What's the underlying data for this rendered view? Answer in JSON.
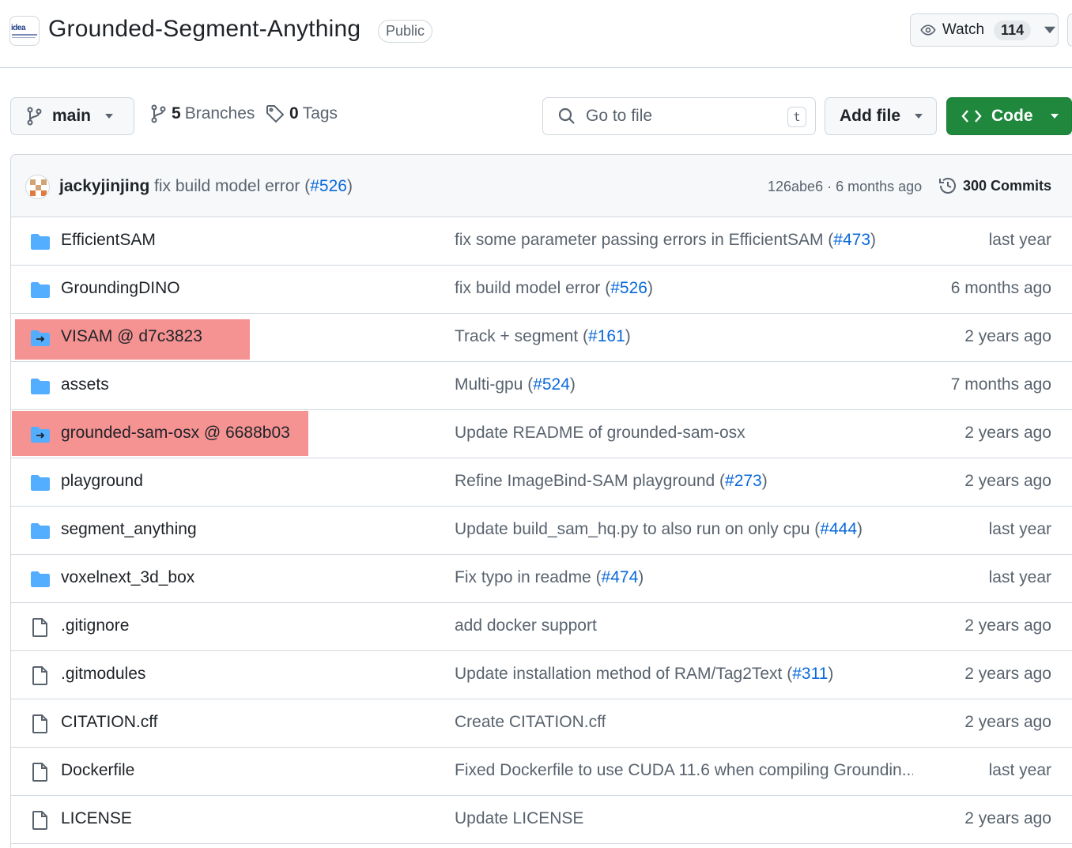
{
  "header": {
    "repo_name": "Grounded-Segment-Anything",
    "visibility": "Public",
    "watch_label": "Watch",
    "watch_count": "114",
    "logo_text": "idea"
  },
  "toolbar": {
    "branch": "main",
    "branches_count": "5",
    "branches_label": "Branches",
    "tags_count": "0",
    "tags_label": "Tags",
    "search_placeholder": "Go to file",
    "search_shortcut": "t",
    "add_file_label": "Add file",
    "code_label": "Code"
  },
  "latest_commit": {
    "author": "jackyjinjing",
    "message": "fix build model error (",
    "pr": "#526",
    "message_end": ")",
    "meta": "126abe6 · 6 months ago",
    "commits_label": "300 Commits"
  },
  "files": [
    {
      "name": "EfficientSAM",
      "type": "folder",
      "msg": "fix some parameter passing errors in EfficientSAM (",
      "pr": "#473",
      "msg_end": ")",
      "age": "last year"
    },
    {
      "name": "GroundingDINO",
      "type": "folder",
      "msg": "fix build model error (",
      "pr": "#526",
      "msg_end": ")",
      "age": "6 months ago"
    },
    {
      "name": "VISAM @ d7c3823",
      "type": "submodule",
      "msg": "Track + segment (",
      "pr": "#161",
      "msg_end": ")",
      "age": "2 years ago",
      "highlighted": true
    },
    {
      "name": "assets",
      "type": "folder",
      "msg": "Multi-gpu (",
      "pr": "#524",
      "msg_end": ")",
      "age": "7 months ago"
    },
    {
      "name": "grounded-sam-osx @ 6688b03",
      "type": "submodule",
      "msg": "Update README of grounded-sam-osx",
      "pr": "",
      "msg_end": "",
      "age": "2 years ago",
      "highlighted": true
    },
    {
      "name": "playground",
      "type": "folder",
      "msg": "Refine ImageBind-SAM playground (",
      "pr": "#273",
      "msg_end": ")",
      "age": "2 years ago"
    },
    {
      "name": "segment_anything",
      "type": "folder",
      "msg": "Update build_sam_hq.py to also run on only cpu (",
      "pr": "#444",
      "msg_end": ")",
      "age": "last year"
    },
    {
      "name": "voxelnext_3d_box",
      "type": "folder",
      "msg": "Fix typo in readme (",
      "pr": "#474",
      "msg_end": ")",
      "age": "last year"
    },
    {
      "name": ".gitignore",
      "type": "file",
      "msg": "add docker support",
      "pr": "",
      "msg_end": "",
      "age": "2 years ago"
    },
    {
      "name": ".gitmodules",
      "type": "file",
      "msg": "Update installation method of RAM/Tag2Text (",
      "pr": "#311",
      "msg_end": ")",
      "age": "2 years ago"
    },
    {
      "name": "CITATION.cff",
      "type": "file",
      "msg": "Create CITATION.cff",
      "pr": "",
      "msg_end": "",
      "age": "2 years ago"
    },
    {
      "name": "Dockerfile",
      "type": "file",
      "msg": "Fixed Dockerfile to use CUDA 11.6 when compiling Groundin...",
      "pr": "",
      "msg_end": "",
      "age": "last year"
    },
    {
      "name": "LICENSE",
      "type": "file",
      "msg": "Update LICENSE",
      "pr": "",
      "msg_end": "",
      "age": "2 years ago"
    }
  ],
  "colors": {
    "folder": "#54aeff",
    "submodule": "#54aeff",
    "link": "#0969da",
    "primary": "#1f883d",
    "highlight": "#f48c8c"
  },
  "icons": {
    "branch": "git-branch-icon",
    "tag": "tag-icon",
    "search": "search-icon",
    "eye": "eye-icon",
    "code": "code-icon",
    "history": "history-icon",
    "folder": "folder-icon",
    "submodule": "submodule-icon",
    "file": "file-icon"
  }
}
